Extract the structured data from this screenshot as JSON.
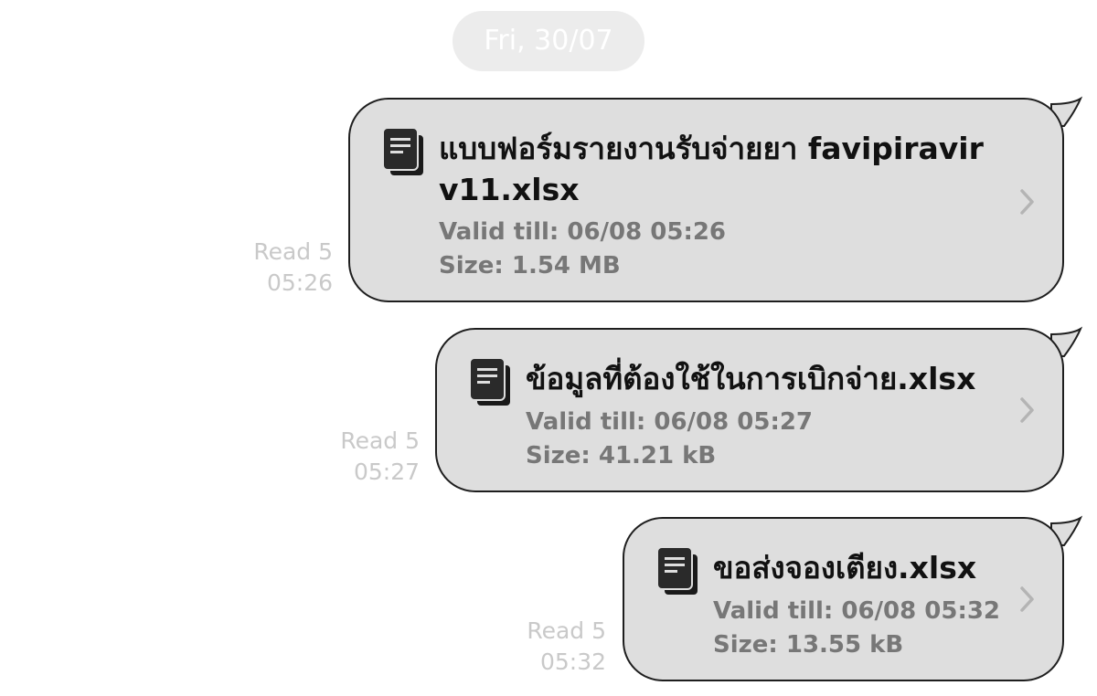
{
  "date_separator": "Fri, 30/07",
  "messages": [
    {
      "filename_line1": "แบบฟอร์มรายงานรับจ่ายยา favipiravir",
      "filename_line2": "v11.xlsx",
      "valid_till": "Valid till: 06/08 05:26",
      "size": "Size: 1.54 MB",
      "read_status": "Read 5",
      "time": "05:26"
    },
    {
      "filename_line1": "ข้อมูลที่ต้องใช้ในการเบิกจ่าย.xlsx",
      "valid_till": "Valid till: 06/08 05:27",
      "size": "Size: 41.21 kB",
      "read_status": "Read 5",
      "time": "05:27"
    },
    {
      "filename_line1": "ขอส่งจองเตียง.xlsx",
      "valid_till": "Valid till: 06/08 05:32",
      "size": "Size: 13.55 kB",
      "read_status": "Read 5",
      "time": "05:32"
    }
  ],
  "icons": {
    "file": "document-icon",
    "open": "chevron-right-icon"
  },
  "colors": {
    "bubble_fill": "#dedede",
    "bubble_border": "#1e1e1e",
    "meta_text": "#c9c9c9",
    "detail_text": "#777777"
  }
}
